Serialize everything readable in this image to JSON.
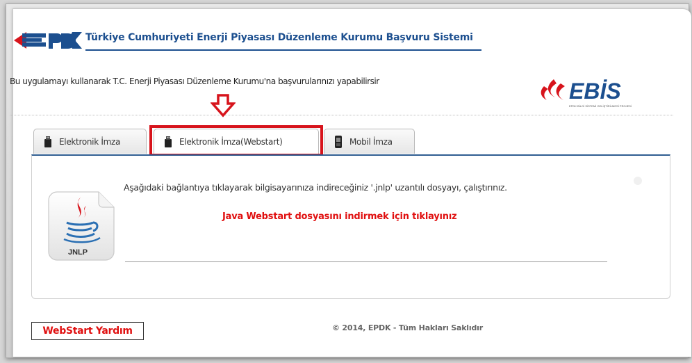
{
  "header": {
    "logo_text": "EPDK",
    "title": "Türkiye Cumhuriyeti Enerji Piyasası Düzenleme Kurumu Başvuru Sistemi"
  },
  "intro_text": "Bu uygulamayı kullanarak T.C. Enerji Piyasası Düzenleme Kurumu'na başvurularınızı yapabilirsir",
  "ebis_logo": {
    "text": "EBİS",
    "subtitle": "EPDK BİLGİ SİSTEMİ GELİŞTİRİLMESİ PROJESİ"
  },
  "tabs": [
    {
      "label": "Elektronik İmza",
      "icon": "usb-token-icon",
      "active": false
    },
    {
      "label": "Elektronik İmza(Webstart)",
      "icon": "usb-token-icon",
      "active": true
    },
    {
      "label": "Mobil İmza",
      "icon": "mobile-phone-icon",
      "active": false
    }
  ],
  "panel": {
    "icon_label": "JNLP",
    "instruction": "Aşağıdaki bağlantıya tıklayarak bilgisayarınıza indireceğiniz '.jnlp' uzantılı dosyayı, çalıştırınız.",
    "download_link": "Java Webstart dosyasını indirmek için tıklayınız"
  },
  "footer": {
    "help_button": "WebStart Yardım",
    "copyright": "© 2014, EPDK - Tüm Hakları Saklıdır"
  },
  "colors": {
    "brand_blue": "#1c4f8f",
    "highlight_red": "#d7141c",
    "link_red": "#e01010"
  }
}
